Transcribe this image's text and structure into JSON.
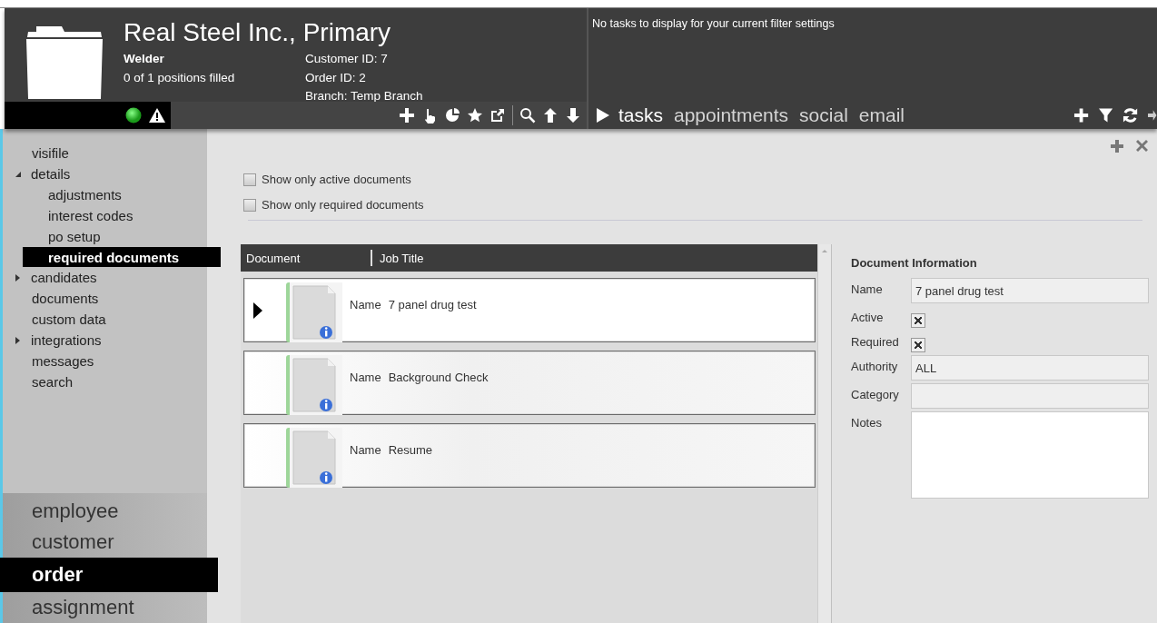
{
  "header": {
    "title": "Real Steel Inc., Primary",
    "job": "Welder",
    "positions": "0 of 1 positions filled",
    "details": [
      "Customer ID: 7",
      "Order ID: 2",
      "Branch: Temp Branch"
    ]
  },
  "tasks": {
    "message": "No tasks to display for your current filter settings",
    "tabs": [
      {
        "label": "tasks",
        "selected": true
      },
      {
        "label": "appointments",
        "selected": false
      },
      {
        "label": "social",
        "selected": false
      },
      {
        "label": "email",
        "selected": false
      }
    ]
  },
  "sidebar": {
    "items": [
      {
        "label": "visifile",
        "selected": false
      },
      {
        "label": "details",
        "selected": false,
        "expanded": true,
        "children": [
          {
            "label": "adjustments",
            "selected": false
          },
          {
            "label": "interest codes",
            "selected": false
          },
          {
            "label": "po setup",
            "selected": false
          },
          {
            "label": "required documents",
            "selected": true
          }
        ]
      },
      {
        "label": "candidates",
        "selected": false,
        "expanded": false
      },
      {
        "label": "documents",
        "selected": false
      },
      {
        "label": "custom data",
        "selected": false
      },
      {
        "label": "integrations",
        "selected": false,
        "expanded": false
      },
      {
        "label": "messages",
        "selected": false
      },
      {
        "label": "search",
        "selected": false
      }
    ],
    "modules": [
      {
        "label": "employee",
        "selected": false
      },
      {
        "label": "customer",
        "selected": false
      },
      {
        "label": "order",
        "selected": true
      },
      {
        "label": "assignment",
        "selected": false
      }
    ]
  },
  "filters": [
    {
      "label": "Show only active documents",
      "checked": false
    },
    {
      "label": "Show only required documents",
      "checked": false
    }
  ],
  "documents": {
    "columns": [
      "Document",
      "Job Title"
    ],
    "rows": [
      {
        "field_label": "Name",
        "name": "7 panel drug test",
        "selected": true
      },
      {
        "field_label": "Name",
        "name": "Background Check",
        "selected": false
      },
      {
        "field_label": "Name",
        "name": "Resume",
        "selected": false
      }
    ]
  },
  "document_info": {
    "title": "Document Information",
    "fields": [
      {
        "kind": "text",
        "label": "Name",
        "value": "7 panel drug test"
      },
      {
        "kind": "checkbox",
        "label": "Active",
        "checked": true
      },
      {
        "kind": "checkbox",
        "label": "Required",
        "checked": true
      },
      {
        "kind": "text",
        "label": "Authority",
        "value": "ALL"
      },
      {
        "kind": "text",
        "label": "Category"
      },
      {
        "kind": "textarea",
        "label": "Notes"
      }
    ]
  }
}
